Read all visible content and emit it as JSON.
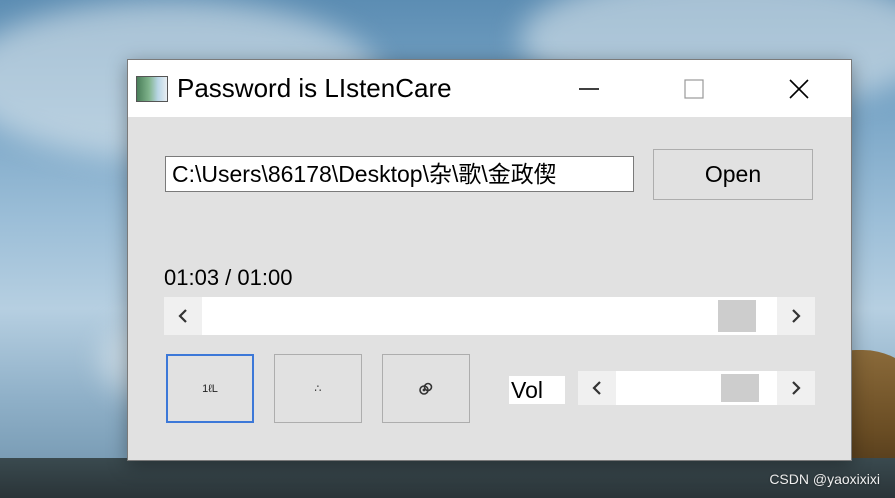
{
  "window": {
    "title": "Password is LIstenCare"
  },
  "file": {
    "path": "C:\\Users\\86178\\Desktop\\杂\\歌\\金政偰",
    "open_label": "Open"
  },
  "playback": {
    "time_display": "01:03 / 01:00",
    "seek_fraction": 0.96
  },
  "controls": [
    {
      "label": "1ℓL",
      "icon": "play-mode-icon"
    },
    {
      "label": "∴",
      "icon": "shuffle-dots-icon"
    },
    {
      "label": "",
      "icon": "loop-link-icon"
    }
  ],
  "volume": {
    "label": "Vol",
    "fraction": 0.85
  },
  "watermark": "CSDN @yaoxixixi",
  "colors": {
    "focus_border": "#3c78d8",
    "window_bg": "#e1e1e1"
  }
}
